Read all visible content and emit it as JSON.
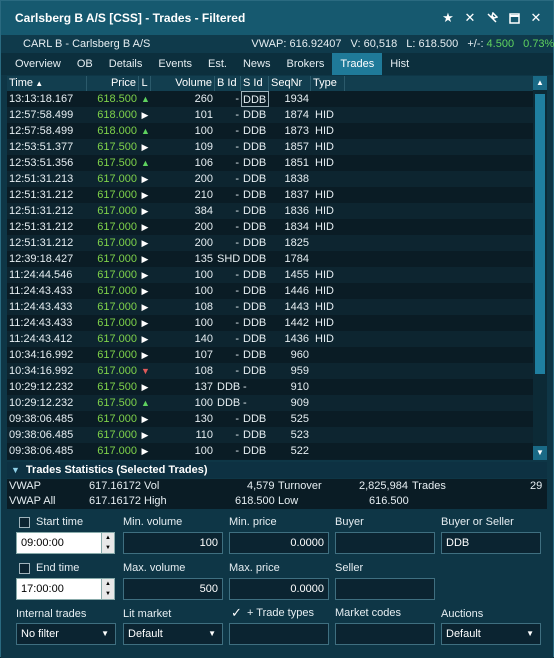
{
  "window": {
    "title": "Carlsberg B A/S [CSS] - Trades - Filtered"
  },
  "titlebar_icons": [
    "star-icon",
    "close-x-icon",
    "unpin-icon",
    "maximize-icon",
    "close-icon"
  ],
  "info": {
    "instrument": "CARL B - Carlsberg B A/S",
    "vwap": "VWAP: 616.92407",
    "volume": "V: 60,518",
    "last": "L: 618.500",
    "change_label": "+/-:",
    "change": "4.500",
    "change_pct": "0.73%"
  },
  "tabs": [
    "Overview",
    "OB",
    "Details",
    "Events",
    "Est.",
    "News",
    "Brokers",
    "Trades",
    "Hist"
  ],
  "active_tab": "Trades",
  "table": {
    "headers": {
      "time": "Time",
      "price": "Price",
      "l": "L",
      "volume": "Volume",
      "bid": "B Id",
      "sid": "S Id",
      "seq": "SeqNr",
      "type": "Type"
    },
    "rows": [
      {
        "time": "13:13:18.167",
        "price": "618.500",
        "l": "up",
        "vol": "260",
        "bid": "-",
        "sid": "DDB",
        "seq": "1934",
        "type": ""
      },
      {
        "time": "12:57:58.499",
        "price": "618.000",
        "l": "flat",
        "vol": "101",
        "bid": "-",
        "sid": "DDB",
        "seq": "1874",
        "type": "HID"
      },
      {
        "time": "12:57:58.499",
        "price": "618.000",
        "l": "up",
        "vol": "100",
        "bid": "-",
        "sid": "DDB",
        "seq": "1873",
        "type": "HID"
      },
      {
        "time": "12:53:51.377",
        "price": "617.500",
        "l": "flat",
        "vol": "109",
        "bid": "-",
        "sid": "DDB",
        "seq": "1857",
        "type": "HID"
      },
      {
        "time": "12:53:51.356",
        "price": "617.500",
        "l": "up",
        "vol": "106",
        "bid": "-",
        "sid": "DDB",
        "seq": "1851",
        "type": "HID"
      },
      {
        "time": "12:51:31.213",
        "price": "617.000",
        "l": "flat",
        "vol": "200",
        "bid": "-",
        "sid": "DDB",
        "seq": "1838",
        "type": ""
      },
      {
        "time": "12:51:31.212",
        "price": "617.000",
        "l": "flat",
        "vol": "210",
        "bid": "-",
        "sid": "DDB",
        "seq": "1837",
        "type": "HID"
      },
      {
        "time": "12:51:31.212",
        "price": "617.000",
        "l": "flat",
        "vol": "384",
        "bid": "-",
        "sid": "DDB",
        "seq": "1836",
        "type": "HID"
      },
      {
        "time": "12:51:31.212",
        "price": "617.000",
        "l": "flat",
        "vol": "200",
        "bid": "-",
        "sid": "DDB",
        "seq": "1834",
        "type": "HID"
      },
      {
        "time": "12:51:31.212",
        "price": "617.000",
        "l": "flat",
        "vol": "200",
        "bid": "-",
        "sid": "DDB",
        "seq": "1825",
        "type": ""
      },
      {
        "time": "12:39:18.427",
        "price": "617.000",
        "l": "flat",
        "vol": "135",
        "bid": "SHD",
        "sid": "DDB",
        "seq": "1784",
        "type": ""
      },
      {
        "time": "11:24:44.546",
        "price": "617.000",
        "l": "flat",
        "vol": "100",
        "bid": "-",
        "sid": "DDB",
        "seq": "1455",
        "type": "HID"
      },
      {
        "time": "11:24:43.433",
        "price": "617.000",
        "l": "flat",
        "vol": "100",
        "bid": "-",
        "sid": "DDB",
        "seq": "1446",
        "type": "HID"
      },
      {
        "time": "11:24:43.433",
        "price": "617.000",
        "l": "flat",
        "vol": "108",
        "bid": "-",
        "sid": "DDB",
        "seq": "1443",
        "type": "HID"
      },
      {
        "time": "11:24:43.433",
        "price": "617.000",
        "l": "flat",
        "vol": "100",
        "bid": "-",
        "sid": "DDB",
        "seq": "1442",
        "type": "HID"
      },
      {
        "time": "11:24:43.412",
        "price": "617.000",
        "l": "flat",
        "vol": "140",
        "bid": "-",
        "sid": "DDB",
        "seq": "1436",
        "type": "HID"
      },
      {
        "time": "10:34:16.992",
        "price": "617.000",
        "l": "flat",
        "vol": "107",
        "bid": "-",
        "sid": "DDB",
        "seq": "960",
        "type": ""
      },
      {
        "time": "10:34:16.992",
        "price": "617.000",
        "l": "down",
        "vol": "108",
        "bid": "-",
        "sid": "DDB",
        "seq": "959",
        "type": ""
      },
      {
        "time": "10:29:12.232",
        "price": "617.500",
        "l": "flat",
        "vol": "137",
        "bid": "DDB",
        "sid": "-",
        "seq": "910",
        "type": ""
      },
      {
        "time": "10:29:12.232",
        "price": "617.500",
        "l": "up",
        "vol": "100",
        "bid": "DDB",
        "sid": "-",
        "seq": "909",
        "type": ""
      },
      {
        "time": "09:38:06.485",
        "price": "617.000",
        "l": "flat",
        "vol": "130",
        "bid": "-",
        "sid": "DDB",
        "seq": "525",
        "type": ""
      },
      {
        "time": "09:38:06.485",
        "price": "617.000",
        "l": "flat",
        "vol": "110",
        "bid": "-",
        "sid": "DDB",
        "seq": "523",
        "type": ""
      },
      {
        "time": "09:38:06.485",
        "price": "617.000",
        "l": "flat",
        "vol": "100",
        "bid": "-",
        "sid": "DDB",
        "seq": "522",
        "type": ""
      }
    ]
  },
  "stats": {
    "title": "Trades Statistics (Selected Trades)",
    "vwap_label": "VWAP",
    "vwap": "617.16172",
    "vol_label": "Vol",
    "vol": "4,579",
    "turnover_label": "Turnover",
    "turnover": "2,825,984",
    "trades_label": "Trades",
    "trades": "29",
    "vwap_all_label": "VWAP All",
    "vwap_all": "617.16172",
    "high_label": "High",
    "high": "618.500",
    "low_label": "Low",
    "low": "616.500"
  },
  "filters": {
    "start_time_label": "Start time",
    "start_time": "09:00:00",
    "end_time_label": "End time",
    "end_time": "17:00:00",
    "min_volume_label": "Min. volume",
    "min_volume": "100",
    "max_volume_label": "Max. volume",
    "max_volume": "500",
    "min_price_label": "Min. price",
    "min_price": "0.0000",
    "max_price_label": "Max. price",
    "max_price": "0.0000",
    "buyer_label": "Buyer",
    "buyer": "",
    "seller_label": "Seller",
    "seller": "",
    "buyer_or_seller_label": "Buyer or Seller",
    "buyer_or_seller": "DDB",
    "internal_trades_label": "Internal trades",
    "internal_trades": "No filter",
    "lit_market_label": "Lit market",
    "lit_market": "Default",
    "trade_types_label": "+ Trade types",
    "trade_types": "",
    "market_codes_label": "Market codes",
    "market_codes": "",
    "auctions_label": "Auctions",
    "auctions": "Default"
  }
}
